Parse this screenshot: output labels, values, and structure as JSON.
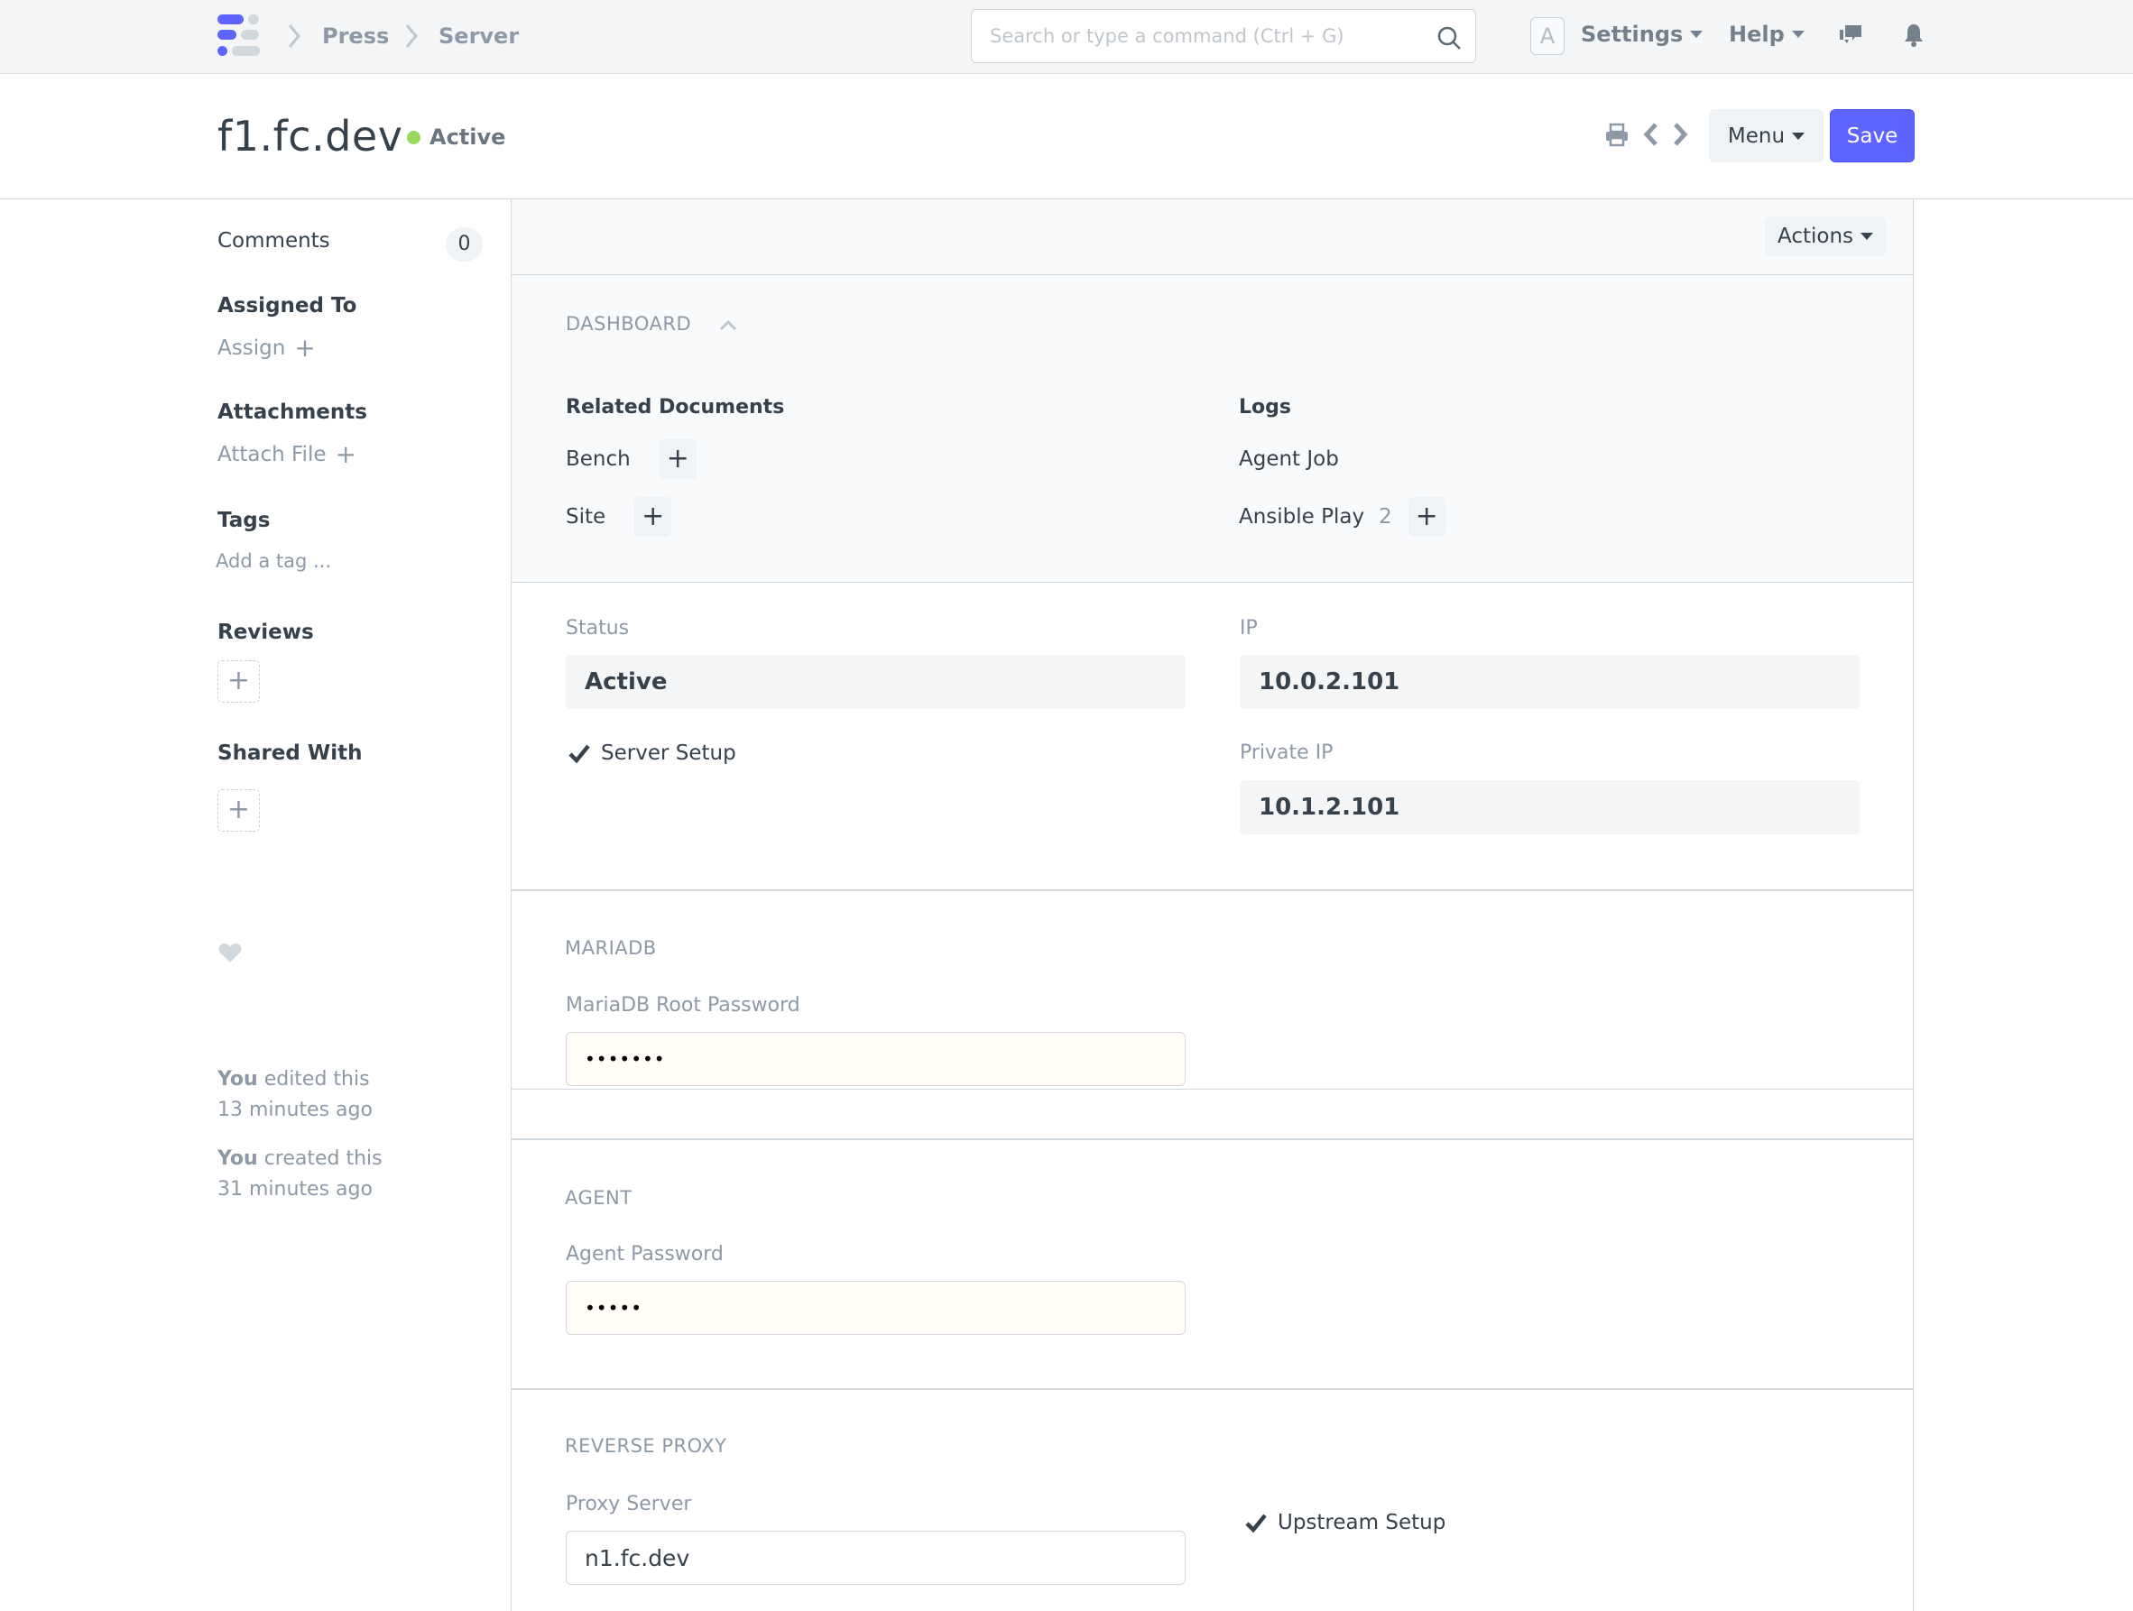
{
  "navbar": {
    "breadcrumbs": [
      "Press",
      "Server"
    ],
    "search_placeholder": "Search or type a command (Ctrl + G)",
    "avatar_letter": "A",
    "settings_label": "Settings",
    "help_label": "Help",
    "icons": [
      "app-logo",
      "search-icon",
      "chat-icon",
      "bell-icon"
    ]
  },
  "page": {
    "title": "f1.fc.dev",
    "status": "Active",
    "status_color": "#98d85b",
    "menu_label": "Menu",
    "save_label": "Save",
    "accent_color": "#5e64ff"
  },
  "sidebar": {
    "comments_label": "Comments",
    "comments_count": "0",
    "assigned_to_label": "Assigned To",
    "assign_label": "Assign",
    "attachments_label": "Attachments",
    "attach_file_label": "Attach File",
    "tags_label": "Tags",
    "add_tag_label": "Add a tag ...",
    "reviews_label": "Reviews",
    "shared_with_label": "Shared With",
    "timeline": [
      {
        "who": "You",
        "action": "edited this",
        "when": "13 minutes ago"
      },
      {
        "who": "You",
        "action": "created this",
        "when": "31 minutes ago"
      }
    ]
  },
  "main": {
    "actions_label": "Actions",
    "dashboard": {
      "title": "DASHBOARD",
      "related_documents": {
        "title": "Related Documents",
        "items": [
          {
            "label": "Bench",
            "count": ""
          },
          {
            "label": "Site",
            "count": ""
          }
        ]
      },
      "logs": {
        "title": "Logs",
        "items": [
          {
            "label": "Agent Job",
            "count": ""
          },
          {
            "label": "Ansible Play",
            "count": "2"
          }
        ]
      }
    },
    "fields": {
      "status_label": "Status",
      "status_value": "Active",
      "server_setup_label": "Server Setup",
      "server_setup_checked": true,
      "ip_label": "IP",
      "ip_value": "10.0.2.101",
      "private_ip_label": "Private IP",
      "private_ip_value": "10.1.2.101"
    },
    "mariadb": {
      "title": "MARIADB",
      "root_password_label": "MariaDB Root Password",
      "root_password_value": "•••••••"
    },
    "agent": {
      "title": "AGENT",
      "password_label": "Agent Password",
      "password_value": "•••••"
    },
    "reverse_proxy": {
      "title": "REVERSE PROXY",
      "proxy_server_label": "Proxy Server",
      "proxy_server_value": "n1.fc.dev",
      "upstream_setup_label": "Upstream Setup",
      "upstream_setup_checked": true
    }
  }
}
